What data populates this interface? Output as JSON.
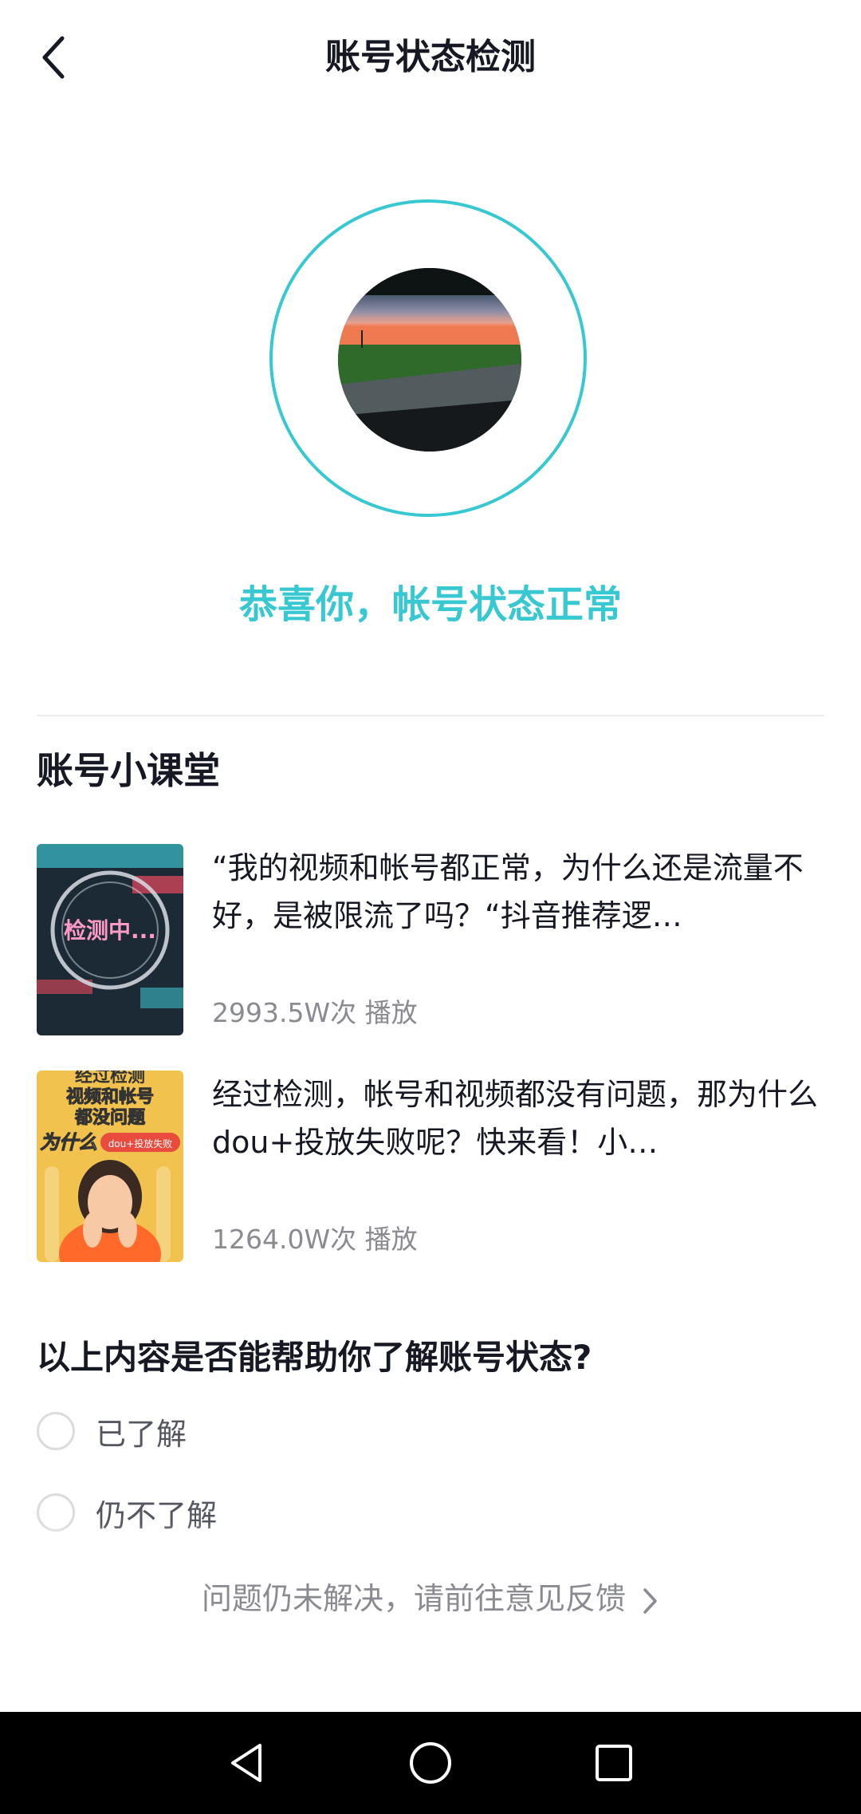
{
  "header": {
    "title": "账号状态检测"
  },
  "status": {
    "text": "恭喜你，帐号状态正常",
    "accent_color": "#38c8d2"
  },
  "lesson": {
    "section_title": "账号小课堂",
    "videos": [
      {
        "title": "“我的视频和帐号都正常，为什么还是流量不好，是被限流了吗？“抖音推荐逻…",
        "plays": "2993.5W次 播放",
        "thumb_text": "检测中..."
      },
      {
        "title": "经过检测，帐号和视频都没有问题，那为什么dou+投放失败呢？快来看！小…",
        "plays": "1264.0W次 播放",
        "thumb_text": [
          "经过检测",
          "视频和帐号",
          "都没问题",
          "为什么",
          "dou+投放失败"
        ]
      }
    ]
  },
  "survey": {
    "question": "以上内容是否能帮助你了解账号状态?",
    "options": [
      "已了解",
      "仍不了解"
    ]
  },
  "feedback": {
    "text": "问题仍未解决，请前往意见反馈"
  },
  "icons": {
    "back": "back-arrow-icon",
    "feedback_chevron": "chevron-right-icon",
    "nav_back": "triangle-back-icon",
    "nav_home": "circle-home-icon",
    "nav_recents": "square-recents-icon"
  }
}
